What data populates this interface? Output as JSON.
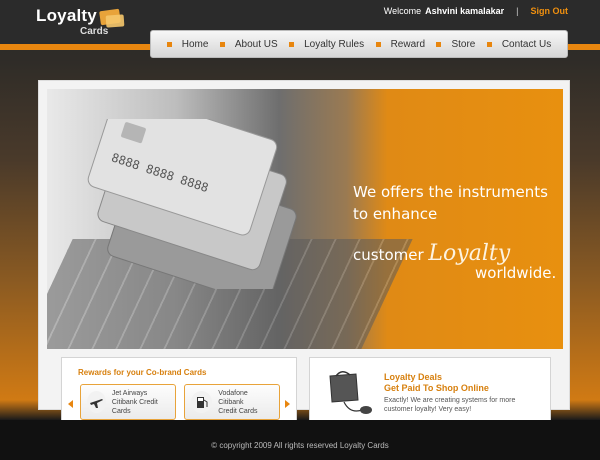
{
  "header": {
    "logo_text": "Loyalty",
    "logo_sub": "Cards",
    "welcome": "Welcome",
    "user_name": "Ashvini kamalakar",
    "separator": "|",
    "signout_label": "Sign Out"
  },
  "nav": {
    "items": [
      {
        "label": "Home"
      },
      {
        "label": "About US"
      },
      {
        "label": "Loyalty Rules"
      },
      {
        "label": "Reward"
      },
      {
        "label": "Store"
      },
      {
        "label": "Contact Us"
      }
    ]
  },
  "banner": {
    "line1": "We offers the instruments",
    "line2": "to enhance",
    "line3_prefix": "customer",
    "line3_script": "Loyalty",
    "line4": "worldwide."
  },
  "cobrand": {
    "title": "Rewards for your Co-brand Cards",
    "cards": [
      {
        "line1": "Jet Airways",
        "line2": "Citibank Credit Cards",
        "icon": "airplane-icon"
      },
      {
        "line1": "Vodafone Citibank",
        "line2": "Credit  Cards",
        "icon": "fuel-pump-icon"
      }
    ]
  },
  "deals": {
    "title_line1": "Loyalty Deals",
    "title_line2": "Get Paid To Shop Online",
    "text_line1": "Exactly! We are creating systems for more",
    "text_line2": "customer loyalty! Very easy!"
  },
  "footer": {
    "copyright": "© copyright 2009 All rights reserved Loyalty Cards"
  },
  "colors": {
    "accent": "#e8860f",
    "header_bg": "#2b2b2b",
    "footer_bg": "#111111"
  }
}
